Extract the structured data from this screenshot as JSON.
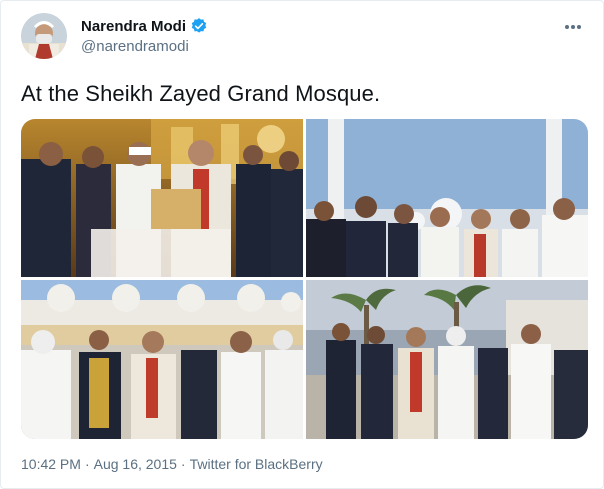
{
  "tweet": {
    "author_name": "Narendra Modi",
    "author_handle": "@narendramodi",
    "text": "At the Sheikh Zayed Grand Mosque.",
    "time": "10:42 PM",
    "separator": "·",
    "date": "Aug 16, 2015",
    "source": "Twitter for BlackBerry",
    "more_icon": "more-horizontal-icon",
    "verified_icon": "verified-badge-icon",
    "accent_color": "#1da1f2"
  }
}
